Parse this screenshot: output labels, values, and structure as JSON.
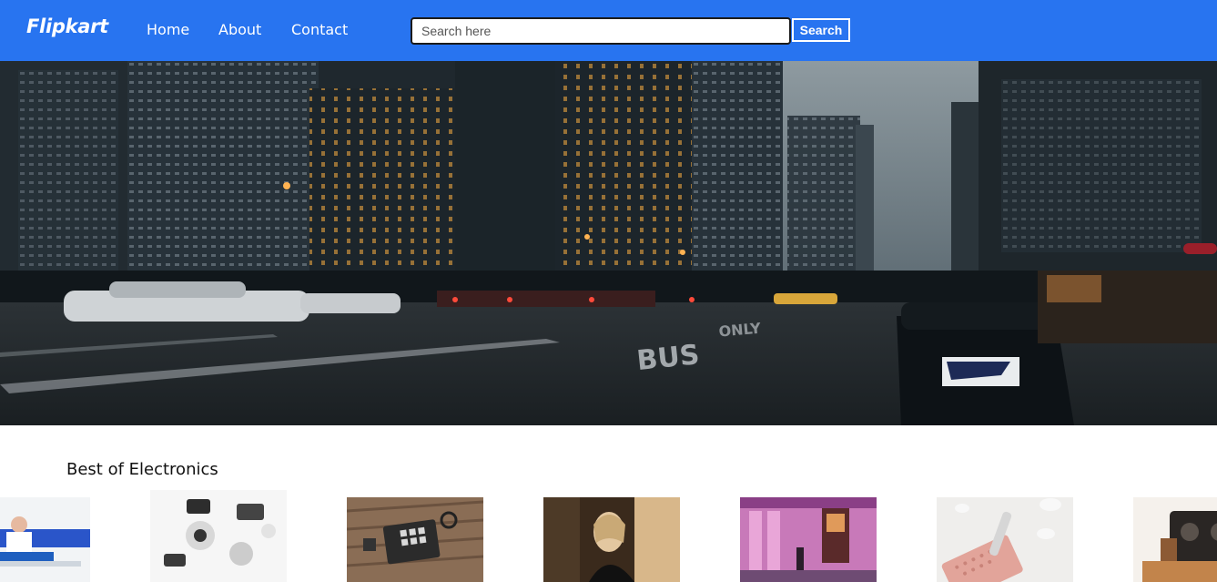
{
  "nav": {
    "logo": "Flipkart",
    "links": [
      "Home",
      "About",
      "Contact"
    ],
    "search": {
      "placeholder": "Search here",
      "button_label": "Search"
    },
    "background_color": "#2874f0"
  },
  "hero": {
    "image": "city-street-at-dusk",
    "road_marking": "BUS",
    "road_marking_secondary": "ONLY"
  },
  "section": {
    "title": "Best of Electronics",
    "products": [
      {
        "image": "person-at-desk"
      },
      {
        "image": "camera-flatlay"
      },
      {
        "image": "drum-machine-on-table"
      },
      {
        "image": "woman-portrait"
      },
      {
        "image": "neon-street"
      },
      {
        "image": "pink-wallet-flatlay"
      },
      {
        "image": "vintage-projector"
      }
    ]
  }
}
